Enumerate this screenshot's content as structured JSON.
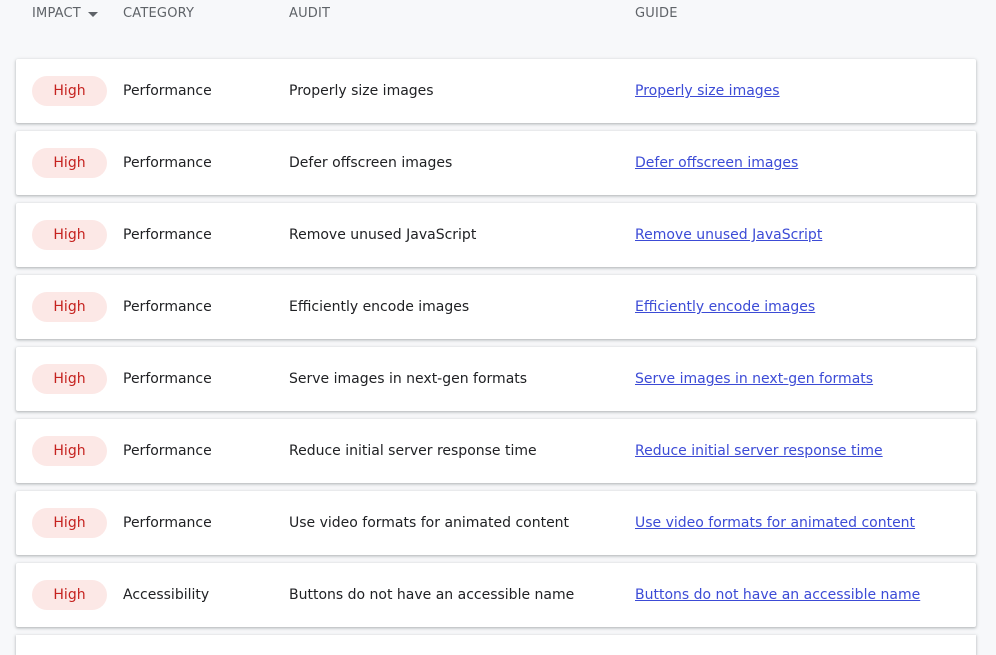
{
  "header": {
    "impact": "IMPACT",
    "category": "CATEGORY",
    "audit": "AUDIT",
    "guide": "GUIDE"
  },
  "rows": [
    {
      "impact": "High",
      "category": "Performance",
      "audit": "Properly size images",
      "guide": "Properly size images"
    },
    {
      "impact": "High",
      "category": "Performance",
      "audit": "Defer offscreen images",
      "guide": "Defer offscreen images"
    },
    {
      "impact": "High",
      "category": "Performance",
      "audit": "Remove unused JavaScript",
      "guide": "Remove unused JavaScript"
    },
    {
      "impact": "High",
      "category": "Performance",
      "audit": "Efficiently encode images",
      "guide": "Efficiently encode images"
    },
    {
      "impact": "High",
      "category": "Performance",
      "audit": "Serve images in next-gen formats",
      "guide": "Serve images in next-gen formats"
    },
    {
      "impact": "High",
      "category": "Performance",
      "audit": "Reduce initial server response time",
      "guide": "Reduce initial server response time"
    },
    {
      "impact": "High",
      "category": "Performance",
      "audit": "Use video formats for animated content",
      "guide": "Use video formats for animated content"
    },
    {
      "impact": "High",
      "category": "Accessibility",
      "audit": "Buttons do not have an accessible name",
      "guide": "Buttons do not have an accessible name"
    }
  ],
  "colors": {
    "high_badge_bg": "#fce8e6",
    "high_badge_text": "#c5221f",
    "link": "#3c4bd6"
  }
}
